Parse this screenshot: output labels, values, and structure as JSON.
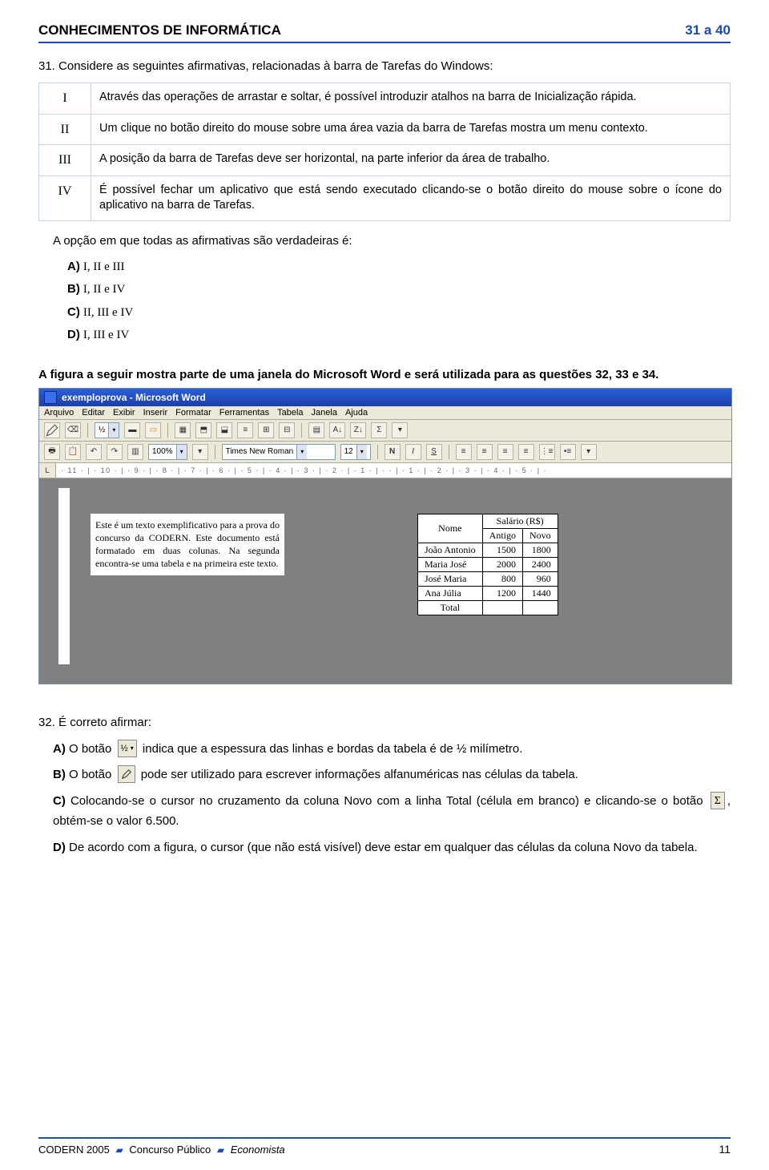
{
  "header": {
    "left": "CONHECIMENTOS DE INFORMÁTICA",
    "right": "31 a 40"
  },
  "q31": {
    "lead": "31. Considere as seguintes afirmativas, relacionadas à barra de Tarefas do Windows:",
    "rows": [
      {
        "roman": "I",
        "text": "Através das operações de arrastar e soltar, é possível introduzir atalhos na barra de Inicialização rápida."
      },
      {
        "roman": "II",
        "text": "Um clique no botão direito do mouse sobre uma área vazia da barra de Tarefas mostra um menu contexto."
      },
      {
        "roman": "III",
        "text": "A posição da barra de Tarefas deve ser horizontal, na parte inferior da área de trabalho."
      },
      {
        "roman": "IV",
        "text": "É possível fechar um aplicativo que está sendo executado clicando-se o botão direito do mouse sobre o ícone do aplicativo na barra de Tarefas."
      }
    ],
    "stem": "A opção em que todas as afirmativas são verdadeiras é:",
    "options": {
      "A": "I, II e III",
      "B": "I, II e IV",
      "C": "II, III e  IV",
      "D": "I, III e IV"
    }
  },
  "figure_intro": "A figura a seguir mostra parte de uma janela do Microsoft Word e será utilizada para as questões 32, 33 e 34.",
  "word": {
    "title": "exemploprova - Microsoft Word",
    "menus": [
      "Arquivo",
      "Editar",
      "Exibir",
      "Inserir",
      "Formatar",
      "Ferramentas",
      "Tabela",
      "Janela",
      "Ajuda"
    ],
    "zoom": "100%",
    "font": "Times New Roman",
    "size": "12",
    "half": "½",
    "ruler_label": "L",
    "ruler_text": "· 11 · | · 10 · | · 9 · | · 8 · | · 7 · | · 6 · | · 5 · | · 4 · | · 3 · | · 2 · | · 1 · | ·     · | · 1 · | · 2 · | · 3 · | · 4 · | · 5 · | ·",
    "paragraph": "Este é um texto exemplificativo para a prova do concurso da CODERN. Este documento está formatado em duas colunas. Na segunda encontra-se uma tabela e na primeira este texto.",
    "table": {
      "head_name": "Nome",
      "head_sal": "Salário (R$)",
      "head_old": "Antigo",
      "head_new": "Novo",
      "rows": [
        {
          "name": "João Antonio",
          "old": "1500",
          "new": "1800"
        },
        {
          "name": "Maria José",
          "old": "2000",
          "new": "2400"
        },
        {
          "name": "José Maria",
          "old": "800",
          "new": "960"
        },
        {
          "name": "Ana Júlia",
          "old": "1200",
          "new": "1440"
        }
      ],
      "total_label": "Total"
    }
  },
  "q32": {
    "lead": "32. É correto afirmar:",
    "A_pre": "O botão",
    "A_post": "indica que a espessura das linhas e bordas da tabela é de ½ milímetro.",
    "B_pre": "O botão",
    "B_post": "pode ser utilizado para escrever informações alfanuméricas nas células da tabela.",
    "C_pre": "Colocando-se o cursor no cruzamento da coluna Novo com a linha Total (célula em branco) e clicando-se o botão",
    "C_post": ", obtém-se o valor 6.500.",
    "D": "De acordo com a figura, o cursor (que não está visível) deve estar em qualquer das células da coluna Novo da tabela.",
    "half_btn": "½",
    "sigma": "Σ"
  },
  "footer": {
    "left1": "CODERN 2005",
    "left2": "Concurso Público",
    "left3": "Economista",
    "page": "11"
  }
}
